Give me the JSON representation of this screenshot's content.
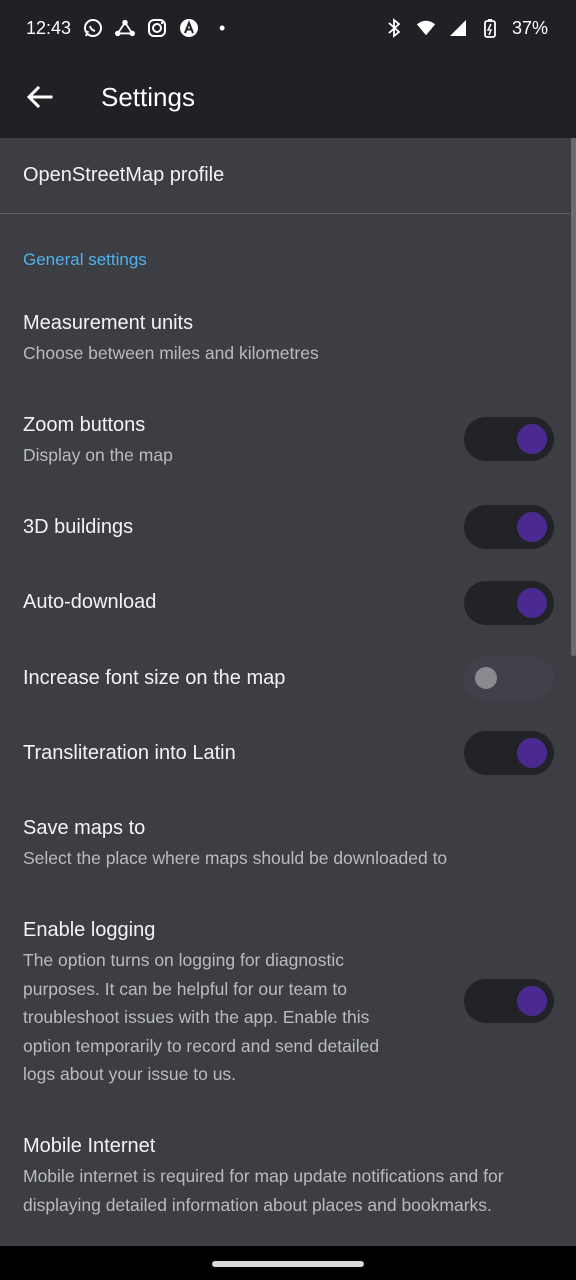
{
  "status": {
    "time": "12:43",
    "dot": "•",
    "battery": "37%",
    "left_icons": [
      "whatsapp-icon",
      "network-icon",
      "instagram-icon",
      "arc-icon"
    ],
    "right_icons": [
      "bluetooth-icon",
      "wifi-icon",
      "signal-icon",
      "battery-icon"
    ]
  },
  "app_bar": {
    "title": "Settings"
  },
  "profile": {
    "label": "OpenStreetMap profile"
  },
  "general": {
    "header": "General settings"
  },
  "settings": {
    "measurement": {
      "title": "Measurement units",
      "subtitle": "Choose between miles and kilometres"
    },
    "zoom": {
      "title": "Zoom buttons",
      "subtitle": "Display on the map",
      "enabled": true
    },
    "buildings": {
      "title": "3D buildings",
      "enabled": true
    },
    "autodownload": {
      "title": "Auto-download",
      "enabled": true
    },
    "fontsize": {
      "title": "Increase font size on the map",
      "enabled": false
    },
    "translit": {
      "title": "Transliteration into Latin",
      "enabled": true
    },
    "savemaps": {
      "title": "Save maps to",
      "subtitle": "Select the place where maps should be downloaded to"
    },
    "logging": {
      "title": "Enable logging",
      "subtitle": "The option turns on logging for diagnostic purposes. It can be helpful for our team to troubleshoot issues with the app. Enable this option temporarily to record and send detailed logs about your issue to us.",
      "enabled": true
    },
    "mobile": {
      "title": "Mobile Internet",
      "subtitle": "Mobile internet is required for map update notifications and for displaying detailed information about places and bookmarks."
    }
  },
  "colors": {
    "accent": "#4fb2ee",
    "toggle_on": "#4a2a91",
    "background": "#3c3e44",
    "appbar": "#202125"
  }
}
